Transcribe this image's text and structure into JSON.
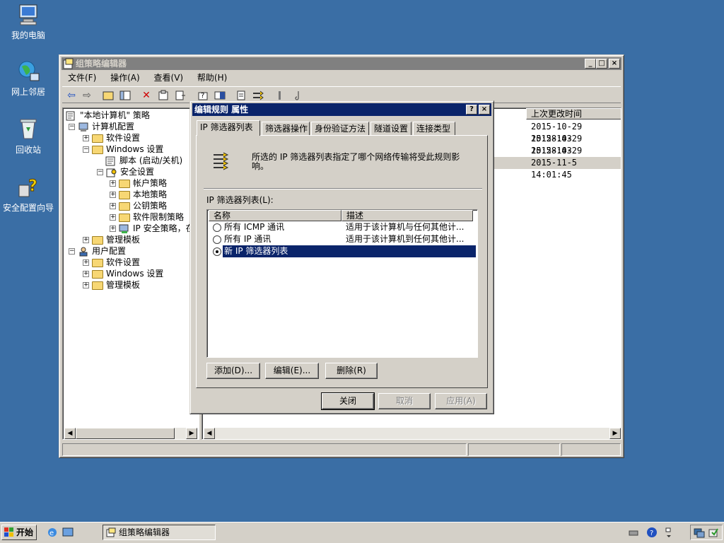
{
  "desktop": {
    "icons": [
      {
        "label": "我的电脑"
      },
      {
        "label": "网上邻居"
      },
      {
        "label": "回收站"
      },
      {
        "label": "安全配置向导"
      }
    ]
  },
  "main_window": {
    "title": "组策略编辑器",
    "controls": {
      "minimize": "_",
      "maximize": "□",
      "close": "×"
    },
    "menu": [
      "文件(F)",
      "操作(A)",
      "查看(V)",
      "帮助(H)"
    ],
    "tree": [
      {
        "label": "\"本地计算机\" 策略",
        "level": 0
      },
      {
        "label": "计算机配置",
        "level": 0,
        "pm": "−"
      },
      {
        "label": "软件设置",
        "level": 1,
        "pm": "+"
      },
      {
        "label": "Windows 设置",
        "level": 1,
        "pm": "−"
      },
      {
        "label": "脚本 (启动/关机)",
        "level": 2
      },
      {
        "label": "安全设置",
        "level": 2,
        "pm": "−"
      },
      {
        "label": "帐户策略",
        "level": 3,
        "pm": "+"
      },
      {
        "label": "本地策略",
        "level": 3,
        "pm": "+"
      },
      {
        "label": "公钥策略",
        "level": 3,
        "pm": "+"
      },
      {
        "label": "软件限制策略",
        "level": 3,
        "pm": "+"
      },
      {
        "label": "IP 安全策略，在",
        "level": 3,
        "pm": "+"
      },
      {
        "label": "管理模板",
        "level": 1,
        "pm": "+"
      },
      {
        "label": "用户配置",
        "level": 0,
        "pm": "−"
      },
      {
        "label": "软件设置",
        "level": 1,
        "pm": "+"
      },
      {
        "label": "Windows 设置",
        "level": 1,
        "pm": "+"
      },
      {
        "label": "管理模板",
        "level": 1,
        "pm": "+"
      }
    ],
    "list_header": {
      "modified": "上次更改时间"
    },
    "list_rows": [
      {
        "modified": "2015-10-29 15:28:43"
      },
      {
        "modified": "2015-10-29 15:28:43"
      },
      {
        "modified": "2015-10-29 15:28:43"
      },
      {
        "modified": "2015-11-5 14:01:45"
      }
    ]
  },
  "dialog": {
    "title": "编辑规则 属性",
    "help": "?",
    "close": "×",
    "tabs": [
      "IP 筛选器列表",
      "筛选器操作",
      "身份验证方法",
      "隧道设置",
      "连接类型"
    ],
    "description": "所选的 IP 筛选器列表指定了哪个网络传输将受此规则影响。",
    "list_label": "IP 筛选器列表(L):",
    "columns": {
      "name": "名称",
      "desc": "描述"
    },
    "rows": [
      {
        "name": "所有 ICMP 通讯",
        "desc": "适用于该计算机与任何其他计...",
        "selected": false
      },
      {
        "name": "所有 IP 通讯",
        "desc": "适用于该计算机到任何其他计...",
        "selected": false
      },
      {
        "name": "新 IP 筛选器列表",
        "desc": "",
        "selected": true
      }
    ],
    "buttons": {
      "add": "添加(D)...",
      "edit": "编辑(E)...",
      "remove": "删除(R)",
      "close": "关闭",
      "cancel": "取消",
      "apply": "应用(A)"
    }
  },
  "taskbar": {
    "start": "开始",
    "task": "组策略编辑器"
  }
}
